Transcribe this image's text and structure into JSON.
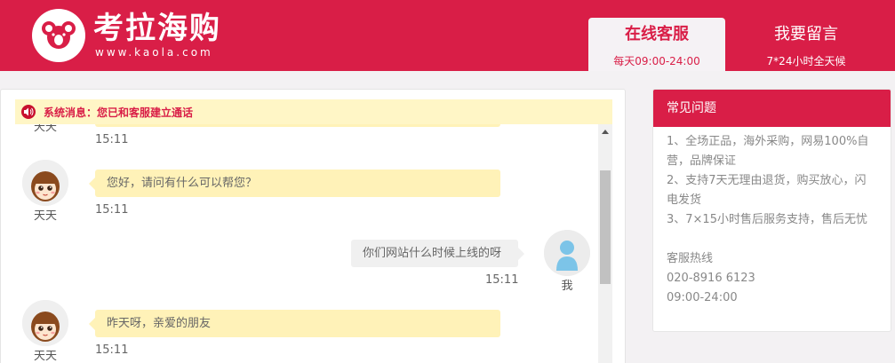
{
  "header": {
    "logo_text": "考拉海购",
    "logo_url": "www.kaola.com",
    "brand_color": "#d91e47"
  },
  "tabs": [
    {
      "title": "在线客服",
      "subtitle": "每天09:00-24:00",
      "active": true
    },
    {
      "title": "我要留言",
      "subtitle": "7*24小时全天候",
      "active": false
    }
  ],
  "system_message": "系统消息：您已和客服建立通话",
  "messages": [
    {
      "sender": "agent",
      "name": "天天",
      "text": "",
      "time": "15:11",
      "partial": true
    },
    {
      "sender": "agent",
      "name": "天天",
      "text": "您好，请问有什么可以帮您？",
      "time": "15:11"
    },
    {
      "sender": "user",
      "name": "我",
      "text": "你们网站什么时候上线的呀",
      "time": "15:11"
    },
    {
      "sender": "agent",
      "name": "天天",
      "text": "昨天呀，亲爱的朋友",
      "time": "15:11"
    }
  ],
  "faq": {
    "title": "常见问题",
    "items": [
      "1、全场正品，海外采购，网易100%自营，品牌保证",
      "2、支持7天无理由退货，购买放心，闪电发货",
      "3、7×15小时售后服务支持，售后无忧"
    ],
    "hotline_label": "客服热线",
    "hotline_number": "020-8916 6123",
    "hotline_hours": "09:00-24:00"
  }
}
